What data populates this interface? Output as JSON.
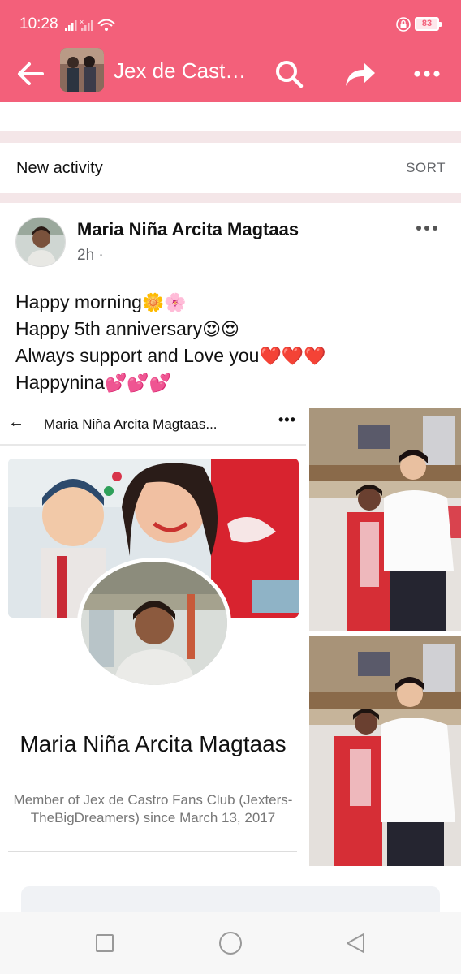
{
  "status_bar": {
    "time": "10:28",
    "battery": "83"
  },
  "header": {
    "group_title": "Jex de Castr…"
  },
  "feed": {
    "section_label": "New activity",
    "sort_label": "SORT"
  },
  "post": {
    "author": "Maria Niña Arcita Magtaas",
    "time": "2h ·",
    "lines": [
      {
        "text": "Happy morning",
        "emoji": "🌼🌸"
      },
      {
        "text": "Happy 5th anniversary",
        "emoji": "😍😍"
      },
      {
        "text": "Always support and Love you",
        "emoji": "❤️❤️❤️"
      },
      {
        "text": "Happynina",
        "emoji": "💕💕💕"
      }
    ],
    "screenshot": {
      "header_title": "Maria Niña Arcita Magtaas...",
      "profile_name": "Maria Niña Arcita Magtaas",
      "member_text": "Member of Jex de Castro Fans Club (Jexters-TheBigDreamers) since March 13, 2017"
    }
  },
  "colors": {
    "brand": "#f3607a",
    "separator": "#f4e6e8",
    "secondary_text": "#65676b"
  },
  "icons": {
    "back": "arrow-left-icon",
    "search": "search-icon",
    "share": "share-arrow-icon",
    "more": "more-horizontal-icon",
    "recents": "square-icon",
    "home": "circle-icon",
    "nav_back": "triangle-back-icon"
  }
}
